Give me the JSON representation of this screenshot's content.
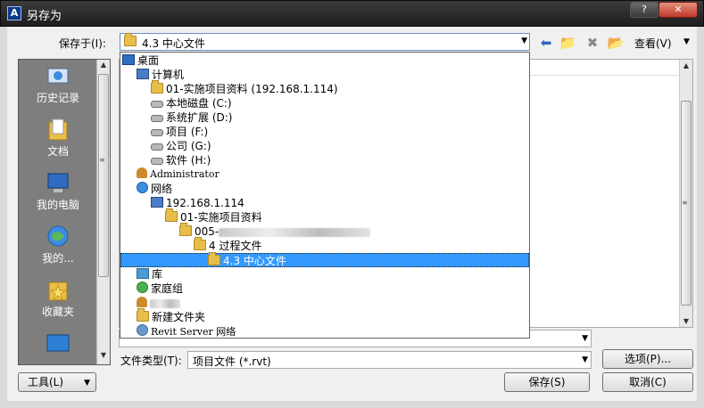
{
  "window": {
    "title": "另存为",
    "help_label": "?",
    "close_label": "✕"
  },
  "toolbar": {
    "save_in_label": "保存于(I):",
    "save_in_value": "4.3 中心文件",
    "view_label": "查看(V)"
  },
  "places": [
    {
      "label": "历史记录",
      "icon": "history-icon"
    },
    {
      "label": "文档",
      "icon": "documents-icon"
    },
    {
      "label": "我的电脑",
      "icon": "computer-icon"
    },
    {
      "label": "我的...",
      "icon": "network-icon"
    },
    {
      "label": "收藏夹",
      "icon": "favorites-icon"
    },
    {
      "label": "",
      "icon": "desktop-icon"
    }
  ],
  "dropdown_items": [
    {
      "label": "桌面",
      "icon": "desktop"
    },
    {
      "label": "计算机",
      "icon": "computer"
    },
    {
      "label": "01-实施项目资料 (192.168.1.114)",
      "icon": "folder"
    },
    {
      "label": "本地磁盘 (C:)",
      "icon": "drive"
    },
    {
      "label": "系统扩展 (D:)",
      "icon": "drive"
    },
    {
      "label": "项目 (F:)",
      "icon": "drive"
    },
    {
      "label": "公司 (G:)",
      "icon": "drive"
    },
    {
      "label": "软件 (H:)",
      "icon": "drive"
    },
    {
      "label": "Administrator",
      "icon": "user"
    },
    {
      "label": "网络",
      "icon": "network"
    },
    {
      "label": "192.168.1.114",
      "icon": "computer"
    },
    {
      "label": "01-实施项目资料",
      "icon": "folder"
    },
    {
      "label": "005-",
      "icon": "folder"
    },
    {
      "label": "4 过程文件",
      "icon": "folder"
    },
    {
      "label": "4.3 中心文件",
      "icon": "folder"
    },
    {
      "label": "库",
      "icon": "lib"
    },
    {
      "label": "家庭组",
      "icon": "homegroup"
    },
    {
      "label": "",
      "icon": "user"
    },
    {
      "label": "新建文件夹",
      "icon": "folder"
    },
    {
      "label": "Revit Server 网络",
      "icon": "revit"
    }
  ],
  "file_type": {
    "label": "文件类型(T):",
    "value": "项目文件 (*.rvt)"
  },
  "buttons": {
    "options": "选项(P)...",
    "tools": "工具(L)",
    "save": "保存(S)",
    "cancel": "取消(C)"
  },
  "colors": {
    "selection": "#3399ff",
    "titlebar": "#2b2b2b",
    "places_bg": "#7e7e7e"
  }
}
